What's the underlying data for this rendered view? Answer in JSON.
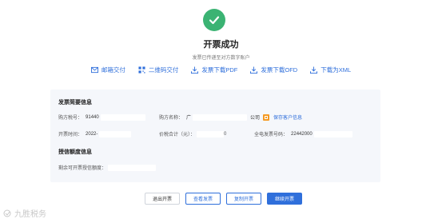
{
  "header": {
    "title": "开票成功",
    "subtitle": "发票已传递至对方数字账户"
  },
  "actions": [
    {
      "label": "邮箱交付",
      "icon": "mail-icon"
    },
    {
      "label": "二维码交付",
      "icon": "qrcode-icon"
    },
    {
      "label": "发票下载PDF",
      "icon": "download-icon"
    },
    {
      "label": "发票下载OFD",
      "icon": "download-icon"
    },
    {
      "label": "下载为XML",
      "icon": "download-icon"
    }
  ],
  "invoice_info": {
    "section_title": "发票简要信息",
    "tax_id_label": "购方税号：",
    "tax_id_value": "91440",
    "buyer_name_label": "购方名称：",
    "buyer_name_value": "广",
    "buyer_name_suffix": "公司",
    "save_customer": "保存客户信息",
    "issue_time_label": "开票时间：",
    "issue_time_value": "2022-",
    "total_label": "价税合计（元）：",
    "total_value": "0",
    "invoice_no_label": "全电发票号码：",
    "invoice_no_value": "22442000"
  },
  "credit_info": {
    "section_title": "授信额度信息",
    "remaining_label": "剩余可开票授信额度：",
    "remaining_value": ""
  },
  "buttons": {
    "exit": "退出开票",
    "view": "查看发票",
    "copy": "复制开票",
    "continue": "继续开票"
  },
  "watermark": "九胜税务",
  "colors": {
    "success": "#3bb373",
    "link": "#2f6fdb",
    "card_bg": "#f5f7fb"
  }
}
